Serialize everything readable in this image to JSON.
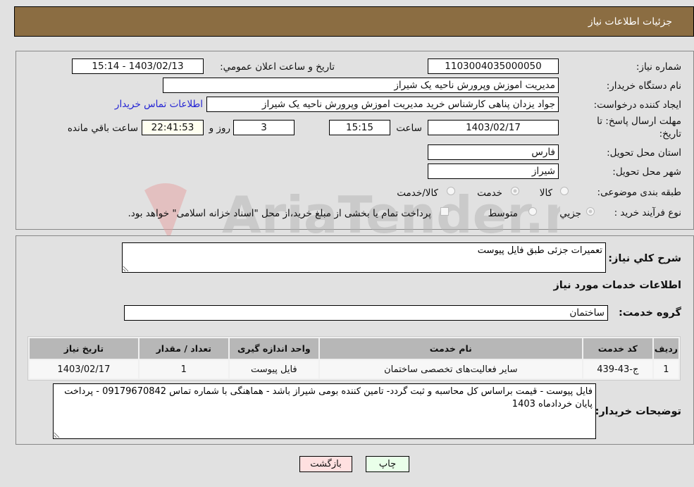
{
  "header": {
    "title": "جزئیات اطلاعات نیاز"
  },
  "form": {
    "need_number": {
      "label": "شماره نیاز:",
      "value": "1103004035000050"
    },
    "announce_datetime": {
      "label": "تاریخ و ساعت اعلان عمومي:",
      "value": "1403/02/13 - 15:14"
    },
    "buyer_org": {
      "label": "نام دستگاه خریدار:",
      "value": "مدیریت اموزش وپرورش ناحیه یک شیراز"
    },
    "requester": {
      "label": "ایجاد کننده درخواست:",
      "value": "جواد یزدان پناهی کارشناس خرید مدیریت اموزش وپرورش ناحیه یک شیراز"
    },
    "buyer_contact_link": "اطلاعات تماس خریدار",
    "deadline": {
      "label_line1": "مهلت ارسال پاسخ: تا",
      "label_line2": "تاریخ:",
      "date": "1403/02/17",
      "time_label": "ساعت",
      "time": "15:15",
      "days": "3",
      "days_label": "روز و",
      "remaining": "22:41:53",
      "remaining_label": "ساعت باقي مانده"
    },
    "province": {
      "label": "استان محل تحویل:",
      "value": "فارس"
    },
    "city": {
      "label": "شهر محل تحویل:",
      "value": "شیراز"
    },
    "category": {
      "label": "طبقه بندی موضوعی:",
      "options": [
        "کالا",
        "خدمت",
        "کالا/خدمت"
      ],
      "selected": "خدمت"
    },
    "purchase_type": {
      "label": "نوع فرآیند خرید :",
      "options": [
        "جزيي",
        "متوسط"
      ],
      "selected": "جزيي",
      "treasury_note": "پرداخت تمام یا بخشی از مبلغ خرید،از محل \"اسناد خزانه اسلامی\" خواهد بود."
    }
  },
  "details": {
    "summary_label": "شرح کلي نیاز:",
    "summary_value": "تعمیرات جزئی طبق فایل پیوست",
    "services_heading": "اطلاعات خدمات مورد نیاز",
    "service_group_label": "گروه خدمت:",
    "service_group_value": "ساختمان",
    "table": {
      "headers": [
        "ردیف",
        "کد خدمت",
        "نام خدمت",
        "واحد اندازه گیری",
        "تعداد / مقدار",
        "تاریخ نیاز"
      ],
      "rows": [
        [
          "1",
          "ج-43-439",
          "سایر فعالیت‌های تخصصی ساختمان",
          "فایل پیوست",
          "1",
          "1403/02/17"
        ]
      ]
    },
    "buyer_notes_label": "توضیحات خریدار:",
    "buyer_notes_value": "فایل پیوست - قیمت براساس کل محاسبه و ثبت گردد- تامین کننده بومی شیراز باشد - هماهنگی با شماره تماس 09179670842 - پرداخت پایان خردادماه 1403"
  },
  "buttons": {
    "print": "چاپ",
    "back": "بازگشت"
  },
  "watermark": "AriaTender.neT",
  "colors": {
    "header_bg": "#8b6d42",
    "print_bg": "#e9ffe9",
    "back_bg": "#ffe0e0",
    "link": "#2323d4"
  }
}
